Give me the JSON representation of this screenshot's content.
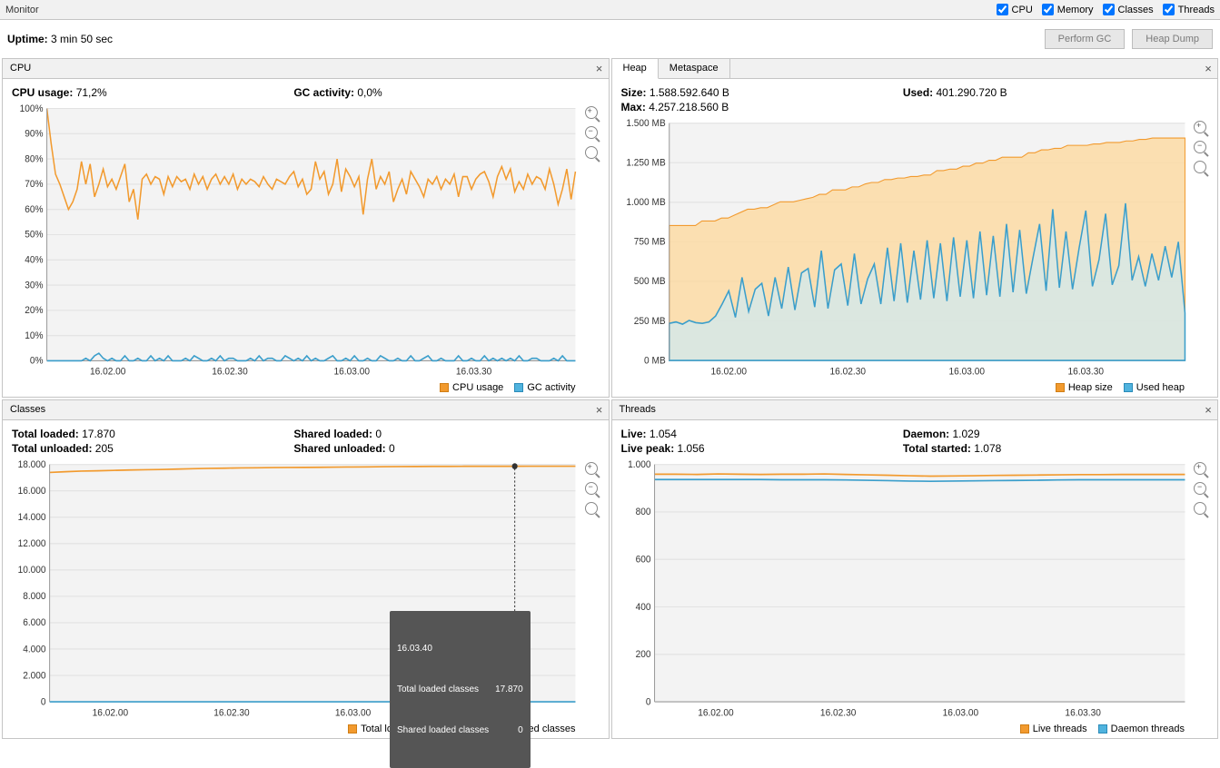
{
  "header": {
    "title": "Monitor",
    "checks": [
      {
        "label": "CPU",
        "checked": true
      },
      {
        "label": "Memory",
        "checked": true
      },
      {
        "label": "Classes",
        "checked": true
      },
      {
        "label": "Threads",
        "checked": true
      }
    ]
  },
  "uptime": {
    "label": "Uptime:",
    "value": "3 min 50 sec"
  },
  "buttons": {
    "perform_gc": "Perform GC",
    "heap_dump": "Heap Dump"
  },
  "panels": {
    "cpu": {
      "title": "CPU",
      "stats": [
        {
          "label": "CPU usage:",
          "value": "71,2%"
        },
        {
          "label": "GC activity:",
          "value": "0,0%"
        }
      ],
      "legend": [
        "CPU usage",
        "GC activity"
      ]
    },
    "heap": {
      "tabs": [
        "Heap",
        "Metaspace"
      ],
      "active_tab": 0,
      "stats_rows": [
        [
          {
            "label": "Size:",
            "value": "1.588.592.640 B"
          },
          {
            "label": "Used:",
            "value": "401.290.720 B"
          }
        ],
        [
          {
            "label": "Max:",
            "value": "4.257.218.560 B"
          },
          {}
        ]
      ],
      "legend": [
        "Heap size",
        "Used heap"
      ]
    },
    "classes": {
      "title": "Classes",
      "stats_rows": [
        [
          {
            "label": "Total loaded:",
            "value": "17.870"
          },
          {
            "label": "Shared loaded:",
            "value": "0"
          }
        ],
        [
          {
            "label": "Total unloaded:",
            "value": "205"
          },
          {
            "label": "Shared unloaded:",
            "value": "0"
          }
        ]
      ],
      "legend": [
        "Total loaded classes",
        "Shared loaded classes"
      ],
      "tooltip": {
        "time": "16.03.40",
        "rows": [
          {
            "label": "Total loaded classes",
            "value": "17.870"
          },
          {
            "label": "Shared loaded classes",
            "value": "0"
          }
        ]
      }
    },
    "threads": {
      "title": "Threads",
      "stats_rows": [
        [
          {
            "label": "Live:",
            "value": "1.054"
          },
          {
            "label": "Daemon:",
            "value": "1.029"
          }
        ],
        [
          {
            "label": "Live peak:",
            "value": "1.056"
          },
          {
            "label": "Total started:",
            "value": "1.078"
          }
        ]
      ],
      "legend": [
        "Live threads",
        "Daemon threads"
      ]
    }
  },
  "chart_data": [
    {
      "id": "cpu",
      "type": "line",
      "title": "CPU",
      "ylabel": "",
      "ylim": [
        0,
        100
      ],
      "yticks": [
        "0%",
        "10%",
        "20%",
        "30%",
        "40%",
        "50%",
        "60%",
        "70%",
        "80%",
        "90%",
        "100%"
      ],
      "xticks": [
        "16.02.00",
        "16.02.30",
        "16.03.00",
        "16.03.30"
      ],
      "x_range_sec": 130,
      "series": [
        {
          "name": "CPU usage",
          "values": [
            100,
            86,
            74,
            70,
            65,
            60,
            63,
            68,
            79,
            70,
            78,
            65,
            70,
            76,
            69,
            72,
            68,
            73,
            78,
            63,
            68,
            56,
            72,
            74,
            70,
            73,
            72,
            66,
            73,
            69,
            73,
            71,
            72,
            68,
            74,
            70,
            73,
            68,
            72,
            74,
            70,
            73,
            70,
            74,
            68,
            72,
            70,
            72,
            71,
            69,
            73,
            70,
            68,
            72,
            71,
            70,
            73,
            75,
            69,
            72,
            66,
            68,
            79,
            72,
            75,
            66,
            70,
            80,
            67,
            76,
            73,
            69,
            73,
            58,
            72,
            80,
            68,
            73,
            70,
            75,
            63,
            68,
            72,
            66,
            75,
            72,
            69,
            65,
            72,
            70,
            73,
            68,
            72,
            70,
            74,
            65,
            73,
            73,
            68,
            72,
            74,
            75,
            71,
            65,
            73,
            77,
            72,
            76,
            67,
            71,
            68,
            74,
            70,
            73,
            72,
            68,
            76,
            70,
            62,
            68,
            76,
            64,
            75
          ]
        },
        {
          "name": "GC activity",
          "values": [
            0,
            0,
            0,
            0,
            0,
            0,
            0,
            0,
            0,
            1,
            0,
            2,
            3,
            1,
            0,
            1,
            0,
            0,
            2,
            0,
            0,
            1,
            0,
            0,
            2,
            0,
            1,
            0,
            2,
            0,
            0,
            0,
            1,
            0,
            2,
            1,
            0,
            0,
            1,
            0,
            2,
            0,
            1,
            1,
            0,
            0,
            0,
            1,
            0,
            2,
            0,
            1,
            1,
            0,
            0,
            2,
            1,
            0,
            1,
            0,
            2,
            0,
            1,
            0,
            0,
            1,
            2,
            0,
            0,
            1,
            0,
            2,
            0,
            0,
            1,
            0,
            0,
            2,
            1,
            0,
            0,
            1,
            0,
            0,
            2,
            0,
            0,
            1,
            2,
            0,
            0,
            1,
            0,
            0,
            0,
            2,
            0,
            0,
            1,
            0,
            0,
            2,
            0,
            1,
            0,
            1,
            0,
            1,
            0,
            2,
            0,
            0,
            1,
            1,
            0,
            0,
            0,
            1,
            0,
            2,
            0,
            0,
            0
          ]
        }
      ]
    },
    {
      "id": "heap",
      "type": "area-line",
      "title": "Heap",
      "ylim": [
        0,
        1600
      ],
      "yticks": [
        "0 MB",
        "250 MB",
        "500 MB",
        "750 MB",
        "1.000 MB",
        "1.250 MB",
        "1.500 MB"
      ],
      "xticks": [
        "16.02.00",
        "16.02.30",
        "16.03.00",
        "16.03.30"
      ],
      "x_range_sec": 130,
      "series": [
        {
          "name": "Heap size",
          "style": "area-orange",
          "values": [
            910,
            910,
            910,
            910,
            910,
            940,
            940,
            940,
            960,
            960,
            980,
            1000,
            1020,
            1020,
            1030,
            1030,
            1050,
            1070,
            1070,
            1070,
            1080,
            1090,
            1100,
            1120,
            1120,
            1150,
            1150,
            1150,
            1170,
            1170,
            1190,
            1200,
            1200,
            1220,
            1220,
            1230,
            1230,
            1240,
            1240,
            1250,
            1250,
            1280,
            1280,
            1290,
            1290,
            1310,
            1310,
            1330,
            1330,
            1350,
            1350,
            1370,
            1370,
            1370,
            1370,
            1400,
            1400,
            1420,
            1420,
            1430,
            1430,
            1450,
            1450,
            1450,
            1450,
            1460,
            1460,
            1470,
            1470,
            1470,
            1480,
            1480,
            1490,
            1490,
            1500,
            1500,
            1500,
            1500,
            1500,
            1500
          ]
        },
        {
          "name": "Used heap",
          "style": "line-blue",
          "values": [
            250,
            260,
            245,
            270,
            255,
            250,
            260,
            300,
            380,
            470,
            290,
            560,
            330,
            480,
            520,
            300,
            560,
            350,
            630,
            340,
            590,
            620,
            360,
            740,
            350,
            610,
            650,
            370,
            720,
            380,
            550,
            650,
            380,
            760,
            400,
            790,
            390,
            740,
            410,
            810,
            420,
            790,
            400,
            830,
            430,
            810,
            420,
            870,
            440,
            840,
            430,
            920,
            460,
            880,
            450,
            690,
            920,
            470,
            1020,
            490,
            870,
            480,
            760,
            1010,
            500,
            680,
            990,
            510,
            640,
            1060,
            540,
            700,
            500,
            720,
            540,
            770,
            560,
            800,
            320
          ]
        }
      ]
    },
    {
      "id": "classes",
      "type": "line",
      "title": "Classes",
      "ylim": [
        0,
        18000
      ],
      "yticks": [
        "0",
        "2.000",
        "4.000",
        "6.000",
        "8.000",
        "10.000",
        "12.000",
        "14.000",
        "16.000",
        "18.000"
      ],
      "xticks": [
        "16.02.00",
        "16.02.30",
        "16.03.00",
        "16.03.30"
      ],
      "x_range_sec": 130,
      "series": [
        {
          "name": "Total loaded classes",
          "values": [
            17400,
            17450,
            17500,
            17520,
            17550,
            17580,
            17600,
            17620,
            17650,
            17680,
            17700,
            17720,
            17740,
            17750,
            17760,
            17770,
            17780,
            17790,
            17800,
            17810,
            17820,
            17830,
            17840,
            17850,
            17855,
            17858,
            17860,
            17862,
            17864,
            17866,
            17868,
            17869,
            17870,
            17870
          ]
        },
        {
          "name": "Shared loaded classes",
          "values": [
            0,
            0,
            0,
            0,
            0,
            0,
            0,
            0,
            0,
            0,
            0,
            0,
            0,
            0,
            0,
            0,
            0,
            0,
            0,
            0,
            0,
            0,
            0,
            0,
            0,
            0,
            0,
            0,
            0,
            0,
            0,
            0,
            0,
            0
          ]
        }
      ],
      "crosshair_sec": 115
    },
    {
      "id": "threads",
      "type": "line",
      "title": "Threads",
      "ylim": [
        0,
        1100
      ],
      "yticks": [
        "0",
        "200",
        "400",
        "600",
        "800",
        "1.000"
      ],
      "xticks": [
        "16.02.00",
        "16.02.30",
        "16.03.00",
        "16.03.30"
      ],
      "x_range_sec": 130,
      "series": [
        {
          "name": "Live threads",
          "values": [
            1055,
            1055,
            1054,
            1056,
            1055,
            1054,
            1055,
            1055,
            1056,
            1054,
            1052,
            1050,
            1048,
            1046,
            1047,
            1048,
            1049,
            1050,
            1051,
            1052,
            1053,
            1053,
            1054,
            1054,
            1054,
            1054
          ]
        },
        {
          "name": "Daemon threads",
          "values": [
            1030,
            1030,
            1030,
            1030,
            1030,
            1030,
            1029,
            1029,
            1029,
            1028,
            1027,
            1025,
            1023,
            1022,
            1023,
            1024,
            1025,
            1026,
            1027,
            1028,
            1029,
            1029,
            1029,
            1029,
            1029,
            1029
          ]
        }
      ]
    }
  ]
}
